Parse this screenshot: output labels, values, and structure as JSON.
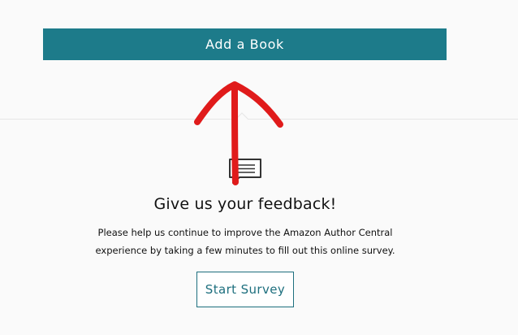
{
  "primary_action": {
    "add_book_label": "Add a Book"
  },
  "feedback": {
    "icon": "chat-bubble-icon",
    "title": "Give us your feedback!",
    "body_line_1": "Please help us continue to improve the Amazon Author Central",
    "body_line_2": "experience by taking a few minutes to fill out this online survey.",
    "survey_button_label": "Start Survey"
  },
  "annotation": {
    "icon": "red-hand-drawn-up-arrow",
    "color": "#e01b1b"
  },
  "colors": {
    "accent": "#1d7b8a",
    "background": "#fafafa"
  }
}
